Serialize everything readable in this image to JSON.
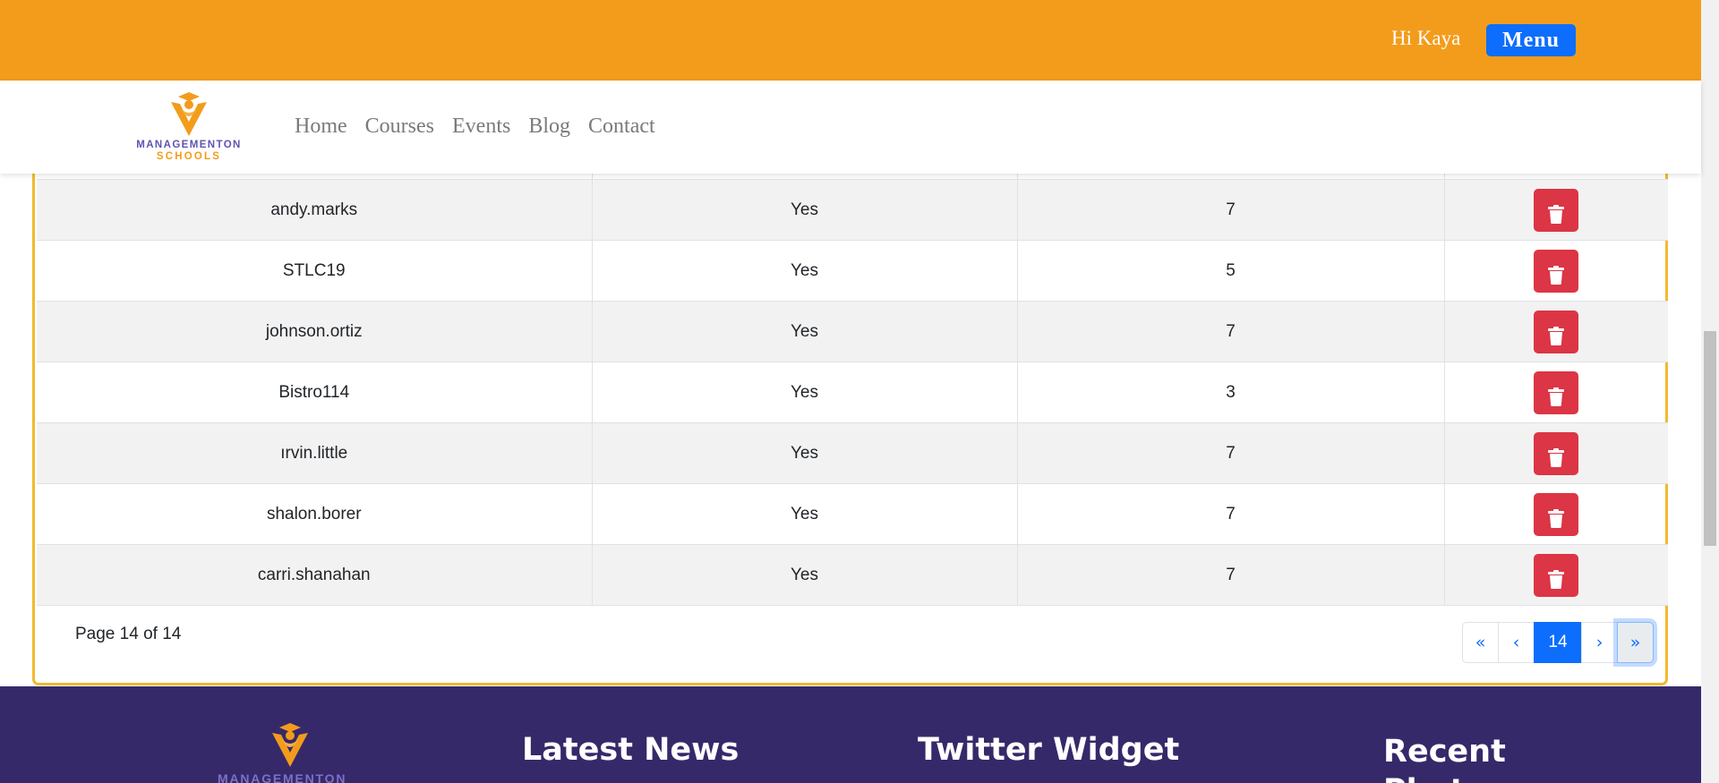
{
  "header": {
    "greeting": "Hi Kaya",
    "menu_label": "Menu",
    "accent_color": "#f39c1b",
    "button_color": "#0d6efd"
  },
  "brand": {
    "line1": "MANAGEMENTON",
    "line2": "SCHOOLS",
    "icon": "graduate-logo-icon"
  },
  "nav": {
    "items": [
      "Home",
      "Courses",
      "Events",
      "Blog",
      "Contact"
    ]
  },
  "table": {
    "rows": [
      {
        "username": "andy.marks",
        "status": "Yes",
        "count": "7"
      },
      {
        "username": "STLC19",
        "status": "Yes",
        "count": "5"
      },
      {
        "username": "johnson.ortiz",
        "status": "Yes",
        "count": "7"
      },
      {
        "username": "Bistro114",
        "status": "Yes",
        "count": "3"
      },
      {
        "username": "ırvin.little",
        "status": "Yes",
        "count": "7"
      },
      {
        "username": "shalon.borer",
        "status": "Yes",
        "count": "7"
      },
      {
        "username": "carri.shanahan",
        "status": "Yes",
        "count": "7"
      }
    ],
    "delete_icon": "trash-icon",
    "delete_color": "#dc3545"
  },
  "pagination": {
    "info": "Page 14 of 14",
    "first": "«",
    "prev": "‹",
    "current": "14",
    "next": "›",
    "last": "»"
  },
  "footer": {
    "brand": "MANAGEMENTON",
    "headings": [
      "Latest News",
      "Twitter Widget",
      "Recent Photos"
    ],
    "background": "#36296a"
  }
}
